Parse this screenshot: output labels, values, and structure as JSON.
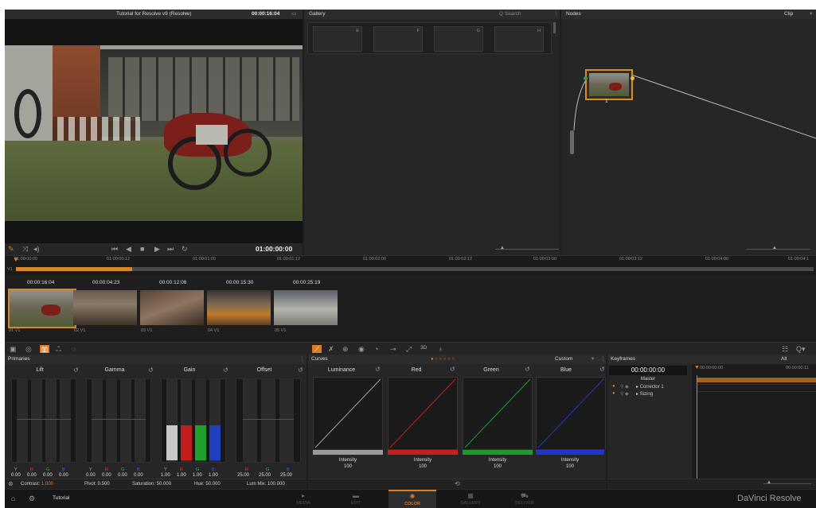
{
  "viewer": {
    "title": "Tutorial for Resolve v9 (Resolve)",
    "timecode": "00:00:16:04",
    "transport_timecode": "01:00:00:00"
  },
  "gallery": {
    "title": "Gallery",
    "search_placeholder": "Q Search",
    "stills": [
      "E",
      "F",
      "G",
      "H"
    ]
  },
  "nodes": {
    "title": "Nodes",
    "mode": "Clip",
    "node_label": "1"
  },
  "timeline": {
    "ruler": [
      "01:00:00:00",
      "01:00:00:12",
      "01:00:01:00",
      "01:00:01:12",
      "01:00:02:00",
      "01:00:02:12",
      "01:00:03:00",
      "01:00:03:12",
      "01:00:04:00",
      "01:00:04:1"
    ],
    "track": "V1"
  },
  "clips": [
    {
      "tc": "00:00:16:04",
      "label": "01  V1"
    },
    {
      "tc": "00:00:04:23",
      "label": "02  V1"
    },
    {
      "tc": "00:00:12:06",
      "label": "03  V1"
    },
    {
      "tc": "00:00:15:30",
      "label": "04  V1"
    },
    {
      "tc": "00:00:25:19",
      "label": "05  V1"
    }
  ],
  "primaries": {
    "title": "Primaries",
    "wheels": [
      {
        "name": "Lift",
        "labels": [
          "Y",
          "R",
          "G",
          "B"
        ],
        "values": [
          "0.00",
          "0.00",
          "0.00",
          "0.00"
        ]
      },
      {
        "name": "Gamma",
        "labels": [
          "Y",
          "R",
          "G",
          "B"
        ],
        "values": [
          "0.00",
          "0.00",
          "0.00",
          "0.00"
        ]
      },
      {
        "name": "Gain",
        "labels": [
          "Y",
          "R",
          "G",
          "B"
        ],
        "values": [
          "1.00",
          "1.00",
          "1.00",
          "1.00"
        ]
      },
      {
        "name": "Offset",
        "labels": [
          "R",
          "G",
          "B"
        ],
        "values": [
          "25.00",
          "25.00",
          "25.00"
        ]
      }
    ],
    "footer": {
      "contrast_label": "Contrast:",
      "contrast_value": "1.000",
      "pivot": "Pivot: 0.500",
      "saturation": "Saturation: 50.000",
      "hue": "Hue: 50.000",
      "lum_mix": "Lum Mix: 100.000"
    }
  },
  "curves": {
    "title": "Curves",
    "mode": "Custom",
    "toolbar_3d": "3D",
    "channels": [
      {
        "name": "Luminance",
        "intensity_label": "Intensity",
        "intensity": "100",
        "color": "#9a9a9a"
      },
      {
        "name": "Red",
        "intensity_label": "Intensity",
        "intensity": "100",
        "color": "#c81e1e"
      },
      {
        "name": "Green",
        "intensity_label": "Intensity",
        "intensity": "100",
        "color": "#1f9a2a"
      },
      {
        "name": "Blue",
        "intensity_label": "Intensity",
        "intensity": "100",
        "color": "#2433c8"
      }
    ]
  },
  "keyframes": {
    "title": "Keyframes",
    "filter": "All",
    "timecode": "00:00:00:00",
    "ruler": [
      "00:00:00:00",
      "00:00:00:11"
    ],
    "tracks": [
      "Master",
      "Corrector 1",
      "Sizing"
    ]
  },
  "bottom_bar": {
    "project": "Tutorial",
    "pages": [
      "MEDIA",
      "EDIT",
      "COLOR",
      "GALLERY",
      "DELIVER"
    ],
    "active_page": "COLOR",
    "brand": "DaVinci Resolve"
  },
  "colors": {
    "accent": "#d9852a",
    "active_page": "#e07a1f"
  }
}
